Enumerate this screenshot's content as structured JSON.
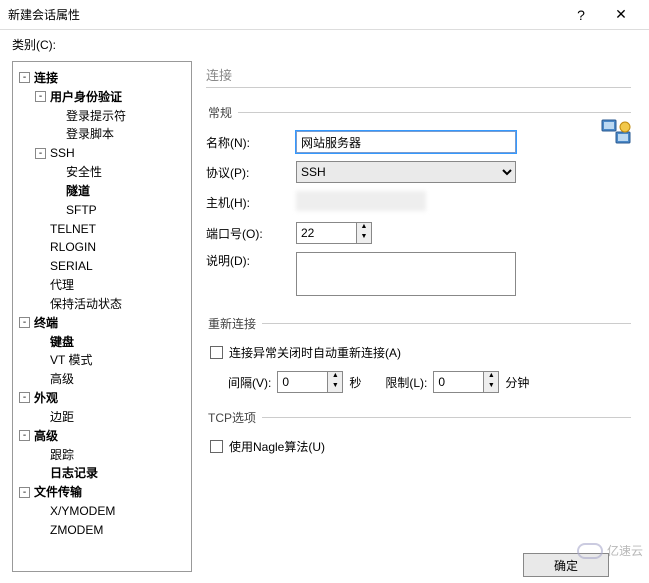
{
  "window": {
    "title": "新建会话属性",
    "help": "?",
    "close": "✕"
  },
  "category_label": "类别(C):",
  "tree": {
    "connection": "连接",
    "auth": "用户身份验证",
    "login_prompt": "登录提示符",
    "login_script": "登录脚本",
    "ssh": "SSH",
    "security": "安全性",
    "tunnel": "隧道",
    "sftp": "SFTP",
    "telnet": "TELNET",
    "rlogin": "RLOGIN",
    "serial": "SERIAL",
    "proxy": "代理",
    "keepalive": "保持活动状态",
    "terminal": "终端",
    "keyboard": "键盘",
    "vtmode": "VT 模式",
    "t_advanced": "高级",
    "appearance": "外观",
    "margin": "边距",
    "advanced": "高级",
    "trace": "跟踪",
    "log": "日志记录",
    "filetransfer": "文件传输",
    "xymodem": "X/YMODEM",
    "zmodem": "ZMODEM"
  },
  "panel": {
    "heading": "连接",
    "general": "常规",
    "name_label": "名称(N):",
    "name_value": "网站服务器",
    "protocol_label": "协议(P):",
    "protocol_value": "SSH",
    "host_label": "主机(H):",
    "port_label": "端口号(O):",
    "port_value": "22",
    "desc_label": "说明(D):",
    "reconnect": "重新连接",
    "reconnect_chk": "连接异常关闭时自动重新连接(A)",
    "interval_label": "间隔(V):",
    "interval_value": "0",
    "interval_unit": "秒",
    "limit_label": "限制(L):",
    "limit_value": "0",
    "limit_unit": "分钟",
    "tcp": "TCP选项",
    "nagle": "使用Nagle算法(U)"
  },
  "footer": {
    "ok": "确定"
  },
  "watermark": "亿速云"
}
